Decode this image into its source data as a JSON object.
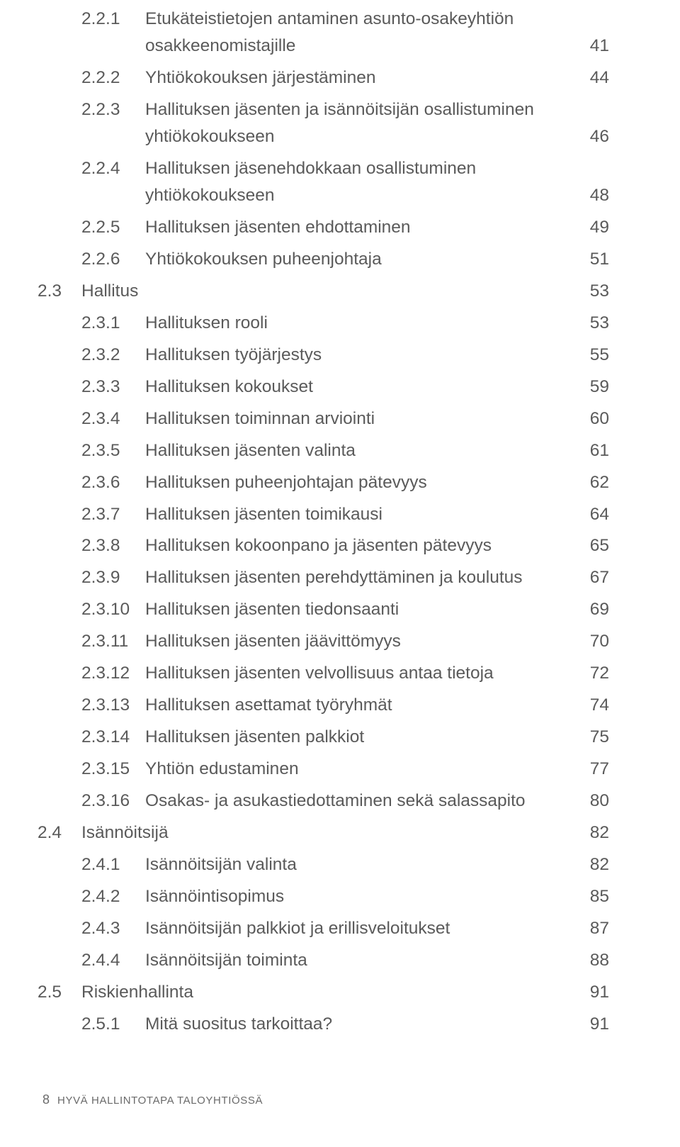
{
  "toc": [
    {
      "num": "2.2.1",
      "title": "Etukäteistietojen antaminen asunto-osakeyhtiön osakkeenomistajille",
      "page": "41",
      "multiline": true
    },
    {
      "num": "2.2.2",
      "title": "Yhtiökokouksen järjestäminen",
      "page": "44"
    },
    {
      "num": "2.2.3",
      "title": "Hallituksen jäsenten ja isännöitsijän osallistuminen yhtiökokoukseen",
      "page": "46",
      "multiline": true
    },
    {
      "num": "2.2.4",
      "title": "Hallituksen jäsenehdokkaan osallistuminen yhtiökokoukseen",
      "page": "48",
      "multiline": true
    },
    {
      "num": "2.2.5",
      "title": "Hallituksen jäsenten ehdottaminen",
      "page": "49"
    },
    {
      "num": "2.2.6",
      "title": "Yhtiökokouksen puheenjohtaja",
      "page": "51"
    },
    {
      "num": "2.3",
      "title": "Hallitus",
      "page": "53",
      "top": true
    },
    {
      "num": "2.3.1",
      "title": "Hallituksen rooli",
      "page": "53"
    },
    {
      "num": "2.3.2",
      "title": "Hallituksen työjärjestys",
      "page": "55"
    },
    {
      "num": "2.3.3",
      "title": "Hallituksen kokoukset",
      "page": "59"
    },
    {
      "num": "2.3.4",
      "title": "Hallituksen toiminnan arviointi",
      "page": "60"
    },
    {
      "num": "2.3.5",
      "title": "Hallituksen jäsenten valinta",
      "page": "61"
    },
    {
      "num": "2.3.6",
      "title": "Hallituksen puheenjohtajan pätevyys",
      "page": "62"
    },
    {
      "num": "2.3.7",
      "title": "Hallituksen jäsenten toimikausi",
      "page": "64"
    },
    {
      "num": "2.3.8",
      "title": "Hallituksen kokoonpano ja jäsenten pätevyys",
      "page": "65"
    },
    {
      "num": "2.3.9",
      "title": "Hallituksen jäsenten perehdyttäminen ja koulutus",
      "page": "67"
    },
    {
      "num": "2.3.10",
      "title": "Hallituksen jäsenten tiedonsaanti",
      "page": "69"
    },
    {
      "num": "2.3.11",
      "title": "Hallituksen jäsenten jäävittömyys",
      "page": "70"
    },
    {
      "num": "2.3.12",
      "title": "Hallituksen jäsenten velvollisuus antaa tietoja",
      "page": "72"
    },
    {
      "num": "2.3.13",
      "title": "Hallituksen asettamat työryhmät",
      "page": "74"
    },
    {
      "num": "2.3.14",
      "title": "Hallituksen jäsenten palkkiot",
      "page": "75"
    },
    {
      "num": "2.3.15",
      "title": "Yhtiön edustaminen",
      "page": "77"
    },
    {
      "num": "2.3.16",
      "title": "Osakas- ja asukastiedottaminen sekä salassapito",
      "page": "80"
    },
    {
      "num": "2.4",
      "title": "Isännöitsijä",
      "page": "82",
      "top": true
    },
    {
      "num": "2.4.1",
      "title": "Isännöitsijän valinta",
      "page": "82"
    },
    {
      "num": "2.4.2",
      "title": "Isännöintisopimus",
      "page": "85"
    },
    {
      "num": "2.4.3",
      "title": "Isännöitsijän palkkiot ja erillisveloitukset",
      "page": "87"
    },
    {
      "num": "2.4.4",
      "title": "Isännöitsijän toiminta",
      "page": "88"
    },
    {
      "num": "2.5",
      "title": "Riskienhallinta",
      "page": "91",
      "top": true
    },
    {
      "num": "2.5.1",
      "title": "Mitä suositus tarkoittaa?",
      "page": "91"
    }
  ],
  "footer": {
    "page_number": "8",
    "doc_title": "HYVÄ HALLINTOTAPA TALOYHTIÖSSÄ"
  }
}
